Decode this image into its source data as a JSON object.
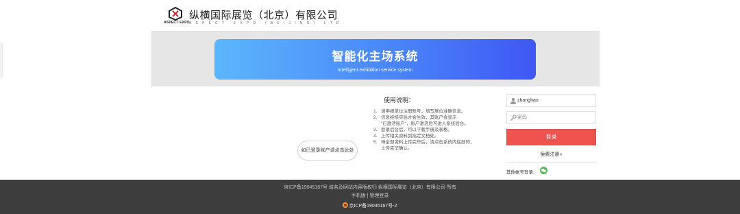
{
  "header": {
    "logo_text": "ASPECT EXPO",
    "company_name": "纵横国际展览（北京）有限公司",
    "company_sub": "ASPECT EXPO (BEIJING) LTD."
  },
  "hero": {
    "title": "智能化主场系统",
    "subtitle": "Intelligent exhibition service system"
  },
  "logged_in_link": "如已登录账户请点击此处",
  "instructions": {
    "title": "使用说明：",
    "items": [
      {
        "num": "1.",
        "text": "请申报单位注册账号，填写展位准确信息。"
      },
      {
        "num": "2.",
        "text": "信息经核实后才会生效，其账户会显示"
      },
      {
        "num": "",
        "text": "“已激活账户”，账户激活后可进入系统后台。"
      },
      {
        "num": "3.",
        "text": "登录后台后，可以下载手册及表格。"
      },
      {
        "num": "4.",
        "text": "上传相关资料到指定文档处。"
      },
      {
        "num": "5.",
        "text": "待全部资料上传完毕后，请点击系统内底部的，"
      },
      {
        "num": "",
        "text": "上传完毕确认。"
      }
    ]
  },
  "login": {
    "username_value": "zhanghao",
    "password_placeholder": "密码",
    "login_button": "登录",
    "free_register": "免费注册»",
    "other_login": "其他帐号登录:"
  },
  "footer": {
    "line1": "京ICP备19045167号 域名及网站内容版权归 纵横国际展览（北京）有限公司 所有",
    "mobile_link": "手机版",
    "separator": "|",
    "admin_link": "管理登录",
    "police_record": "京ICP备19045167号-2"
  },
  "colors": {
    "hero_gradient_start": "#5cb6fb",
    "hero_gradient_end": "#3f57f4",
    "login_button": "#ef5350",
    "footer_bg": "#3d3d3d"
  }
}
